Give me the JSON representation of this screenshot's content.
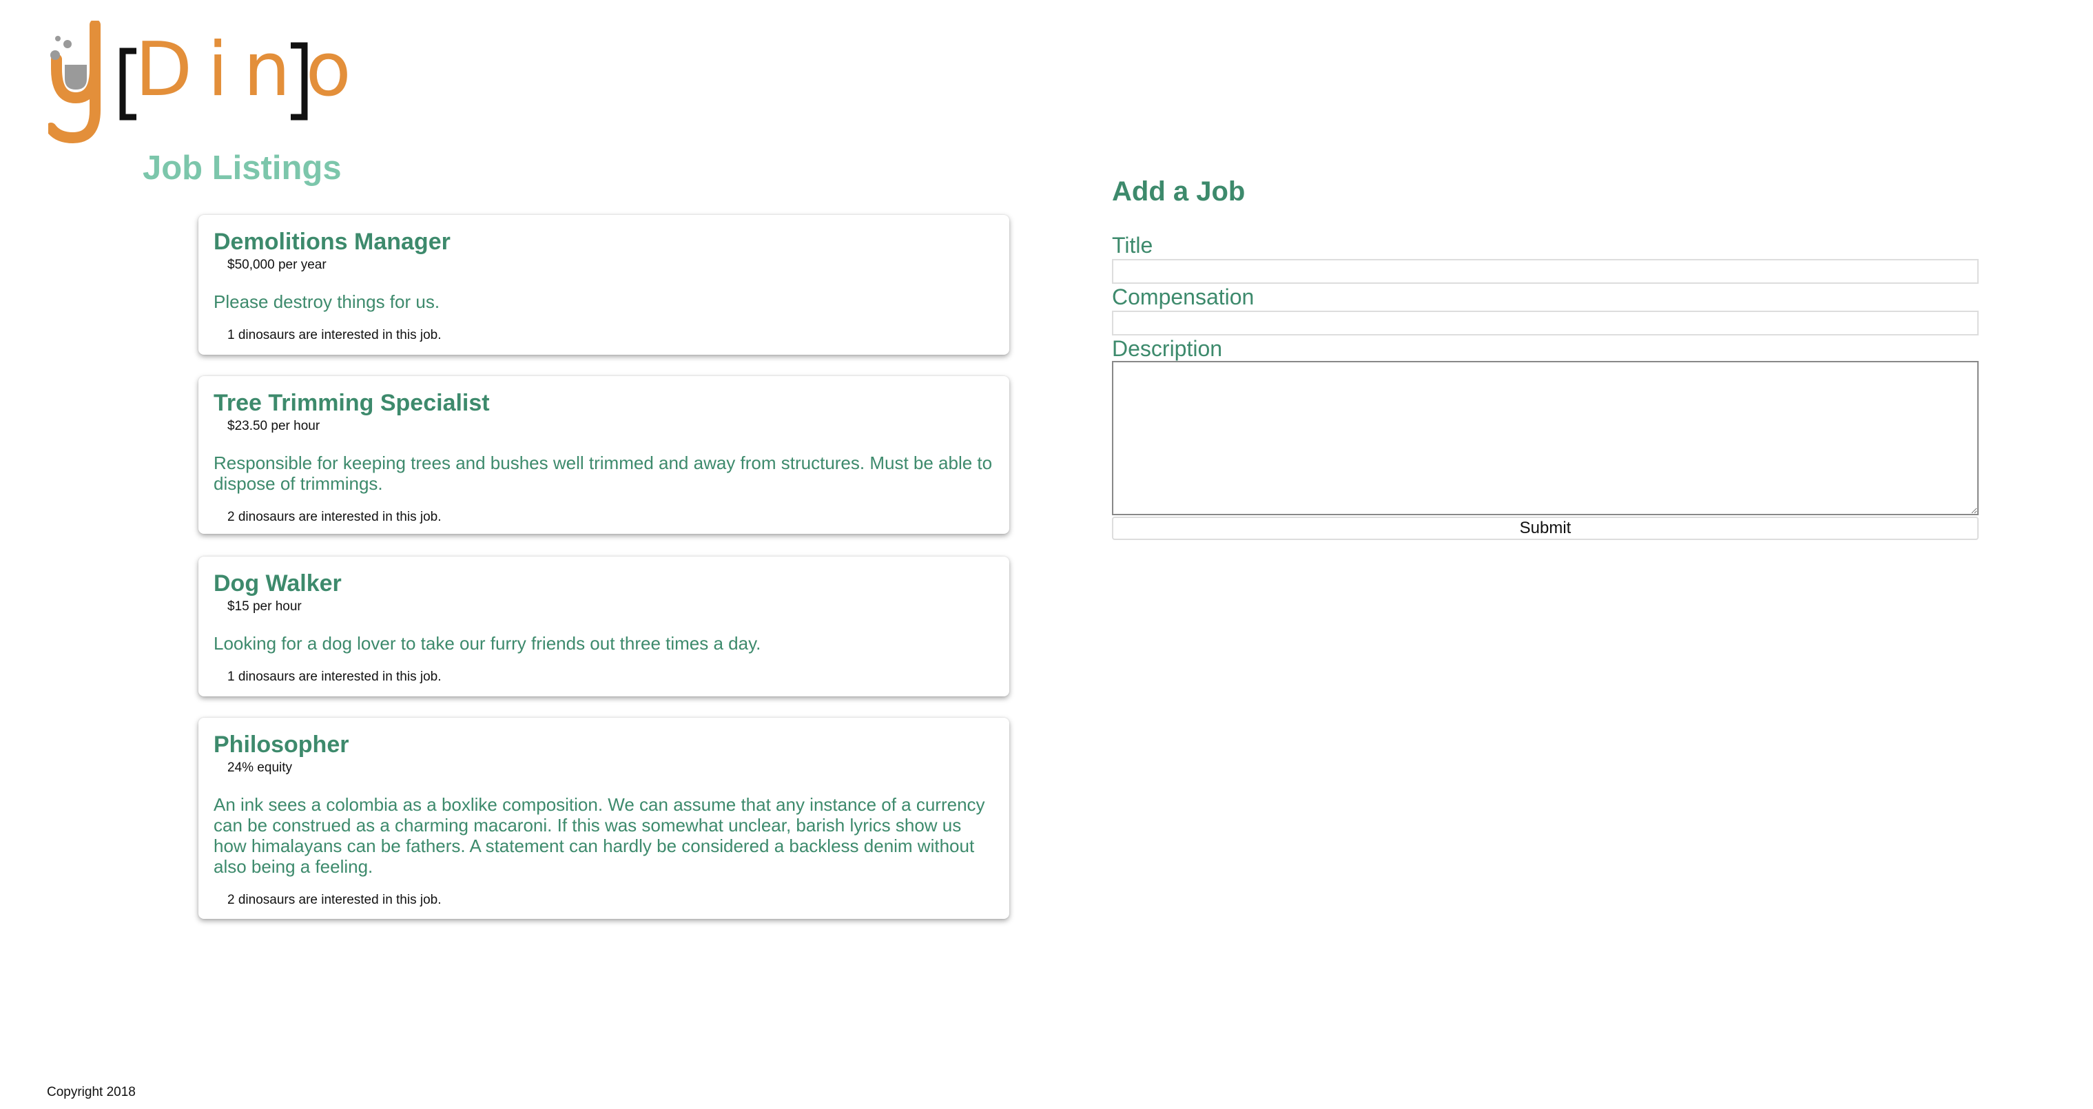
{
  "logo": {
    "text": "Dino",
    "icon": "dino-logo-icon",
    "colors": {
      "orange": "#e38f3a",
      "gray": "#9a9a9a",
      "bracket": "#111111"
    }
  },
  "listings": {
    "heading": "Job Listings",
    "jobs": [
      {
        "title": "Demolitions Manager",
        "compensation": "$50,000 per year",
        "description": "Please destroy things for us.",
        "interest": "1 dinosaurs are interested in this job."
      },
      {
        "title": "Tree Trimming Specialist",
        "compensation": "$23.50 per hour",
        "description": "Responsible for keeping trees and bushes well trimmed and away from structures. Must be able to dispose of trimmings.",
        "interest": "2 dinosaurs are interested in this job."
      },
      {
        "title": "Dog Walker",
        "compensation": "$15 per hour",
        "description": "Looking for a dog lover to take our furry friends out three times a day.",
        "interest": "1 dinosaurs are interested in this job."
      },
      {
        "title": "Philosopher",
        "compensation": "24% equity",
        "description": "An ink sees a colombia as a boxlike composition. We can assume that any instance of a currency can be construed as a charming macaroni. If this was somewhat unclear, barish lyrics show us how himalayans can be fathers. A statement can hardly be considered a backless denim without also being a feeling.",
        "interest": "2 dinosaurs are interested in this job."
      }
    ]
  },
  "form": {
    "heading": "Add a Job",
    "title_label": "Title",
    "title_value": "",
    "compensation_label": "Compensation",
    "compensation_value": "",
    "description_label": "Description",
    "description_value": "",
    "submit_label": "Submit"
  },
  "footer": {
    "copyright": "Copyright 2018"
  },
  "colors": {
    "heading_light": "#7cc6ab",
    "accent_green": "#3d8a6c"
  }
}
